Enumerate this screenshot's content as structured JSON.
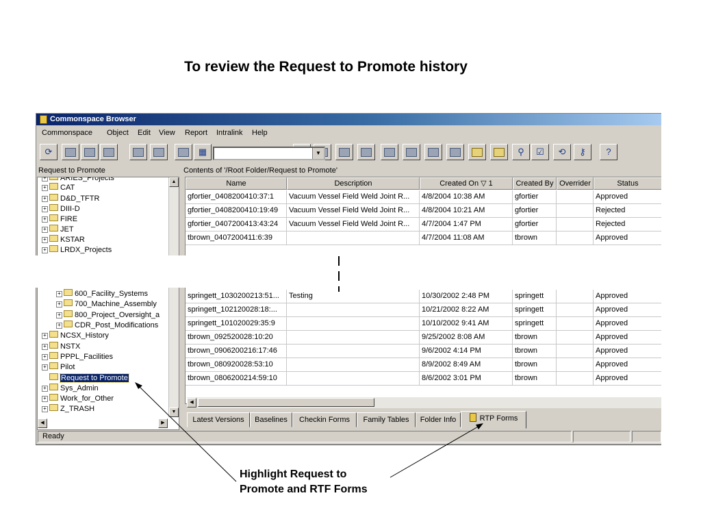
{
  "slide": {
    "title": "To review the Request to Promote history",
    "callout_line1": "Highlight Request to",
    "callout_line2": "Promote and RTF Forms"
  },
  "window": {
    "title": "Commonspace Browser",
    "menu": [
      "Commonspace",
      "Object",
      "Edit",
      "View",
      "Report",
      "Intralink",
      "Help"
    ],
    "combo_value": ""
  },
  "left_pane": {
    "header": "Request to Promote",
    "tree_top": [
      "ARIES_Projects",
      "CAT",
      "D&D_TFTR",
      "DIII-D",
      "FIRE",
      "JET",
      "KSTAR",
      "LRDX_Projects"
    ],
    "tree_bottom_sub": [
      "600_Facility_Systems",
      "700_Machine_Assembly",
      "800_Project_Oversight_a",
      "CDR_Post_Modifications"
    ],
    "tree_bottom": [
      "NCSX_History",
      "NSTX",
      "PPPL_Facilities",
      "Pilot",
      "Request to Promote",
      "Sys_Admin",
      "Work_for_Other",
      "Z_TRASH"
    ],
    "selected": "Request to Promote"
  },
  "right_pane": {
    "header": "Contents of '/Root Folder/Request to Promote'",
    "columns": [
      "Name",
      "Description",
      "Created On ▽ 1",
      "Created By",
      "Overrider",
      "Status"
    ],
    "rows_top": [
      [
        "gfortier_0408200410:37:1",
        "Vacuum Vessel Field Weld Joint R...",
        "4/8/2004 10:38 AM",
        "gfortier",
        "",
        "Approved"
      ],
      [
        "gfortier_0408200410:19:49",
        "Vacuum Vessel Field Weld Joint R...",
        "4/8/2004 10:21 AM",
        "gfortier",
        "",
        "Rejected"
      ],
      [
        "gfortier_0407200413:43:24",
        "Vacuum Vessel Field Weld Joint R...",
        "4/7/2004 1:47 PM",
        "gfortier",
        "",
        "Rejected"
      ],
      [
        "tbrown_0407200411:6:39",
        "",
        "4/7/2004 11:08 AM",
        "tbrown",
        "",
        "Approved"
      ]
    ],
    "rows_bottom": [
      [
        "springett_1030200213:51...",
        "Testing",
        "10/30/2002 2:48 PM",
        "springett",
        "",
        "Approved"
      ],
      [
        "springett_102120028:18:...",
        "",
        "10/21/2002 8:22 AM",
        "springett",
        "",
        "Approved"
      ],
      [
        "springett_101020029:35:9",
        "",
        "10/10/2002 9:41 AM",
        "springett",
        "",
        "Approved"
      ],
      [
        "tbrown_092520028:10:20",
        "",
        "9/25/2002 8:08 AM",
        "tbrown",
        "",
        "Approved"
      ],
      [
        "tbrown_0906200216:17:46",
        "",
        "9/6/2002 4:14 PM",
        "tbrown",
        "",
        "Approved"
      ],
      [
        "tbrown_080920028:53:10",
        "",
        "8/9/2002 8:49 AM",
        "tbrown",
        "",
        "Approved"
      ],
      [
        "tbrown_0806200214:59:10",
        "",
        "8/6/2002 3:01 PM",
        "tbrown",
        "",
        "Approved"
      ]
    ],
    "tabs": [
      "Latest Versions",
      "Baselines",
      "Checkin Forms",
      "Family Tables",
      "Folder Info",
      "RTP Forms"
    ],
    "active_tab": "RTP Forms"
  },
  "status": {
    "text": "Ready"
  },
  "colors": {
    "title_bar": "#0a246a",
    "selection": "#0a246a",
    "window_face": "#d4d0c8"
  },
  "icons": [
    "refresh-icon",
    "folder-icon",
    "binoculars-icon",
    "help-icon",
    "key-icon"
  ]
}
